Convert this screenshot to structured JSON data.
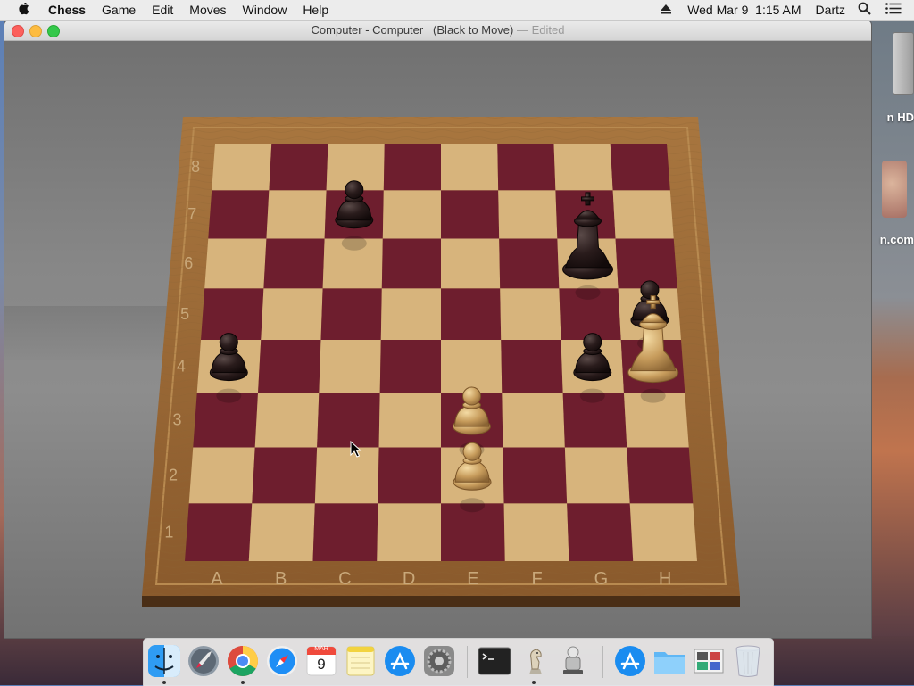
{
  "menubar": {
    "app_name": "Chess",
    "items": [
      "Game",
      "Edit",
      "Moves",
      "Window",
      "Help"
    ],
    "clock": "Wed Mar 9  1:15 AM",
    "user": "Dartz"
  },
  "window": {
    "title": "Computer - Computer   (Black to Move)",
    "edited": " — Edited"
  },
  "desktop": {
    "label_hd": "n HD",
    "label_com": "n.com"
  },
  "board": {
    "files": [
      "A",
      "B",
      "C",
      "D",
      "E",
      "F",
      "G",
      "H"
    ],
    "ranks": [
      "8",
      "7",
      "6",
      "5",
      "4",
      "3",
      "2",
      "1"
    ],
    "light_color": "#d7b47c",
    "dark_color": "#6e1e2e",
    "frame_color": "#9b6a3a",
    "pieces": [
      {
        "type": "pawn",
        "color": "black",
        "square": "c7"
      },
      {
        "type": "king",
        "color": "black",
        "square": "g6"
      },
      {
        "type": "pawn",
        "color": "black",
        "square": "h5"
      },
      {
        "type": "pawn",
        "color": "black",
        "square": "a4"
      },
      {
        "type": "pawn",
        "color": "black",
        "square": "g4"
      },
      {
        "type": "king",
        "color": "white",
        "square": "h4"
      },
      {
        "type": "pawn",
        "color": "white",
        "square": "e3"
      },
      {
        "type": "pawn",
        "color": "white",
        "square": "e2"
      }
    ]
  },
  "dock": {
    "apps": [
      "finder-icon",
      "launchpad-icon",
      "chrome-icon",
      "safari-icon",
      "calendar-icon",
      "notes-icon",
      "app-store-icon",
      "system-preferences-icon",
      "terminal-icon",
      "chess-icon",
      "automator-icon",
      "app-store-download-icon",
      "folder-icon",
      "photos-stack-icon",
      "trash-icon"
    ],
    "calendar_month": "MAR",
    "calendar_day": "9"
  }
}
